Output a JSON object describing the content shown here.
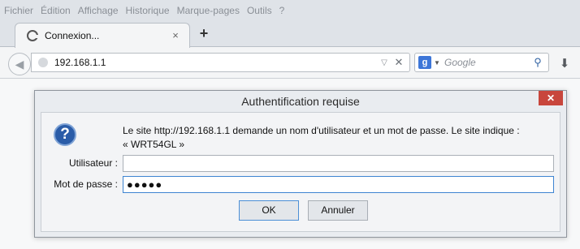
{
  "menu": [
    {
      "label": "Fichier"
    },
    {
      "label": "Édition"
    },
    {
      "label": "Affichage"
    },
    {
      "label": "Historique"
    },
    {
      "label": "Marque-pages"
    },
    {
      "label": "Outils"
    },
    {
      "label": "?"
    }
  ],
  "tab": {
    "title": "Connexion...",
    "close": "×"
  },
  "newtab": "+",
  "url": {
    "value": "192.168.1.1"
  },
  "search": {
    "engine": "g",
    "placeholder": "Google"
  },
  "dialog": {
    "title": "Authentification requise",
    "close": "✕",
    "message_line1": "Le site http://192.168.1.1 demande un nom d'utilisateur et un mot de passe. Le site indique :",
    "message_line2": "« WRT54GL »",
    "user_label": "Utilisateur :",
    "user_value": "",
    "pass_label": "Mot de passe :",
    "pass_value": "●●●●●",
    "ok": "OK",
    "cancel": "Annuler"
  },
  "icons": {
    "back": "back-arrow-icon",
    "question": "question-icon",
    "download": "download-icon"
  }
}
